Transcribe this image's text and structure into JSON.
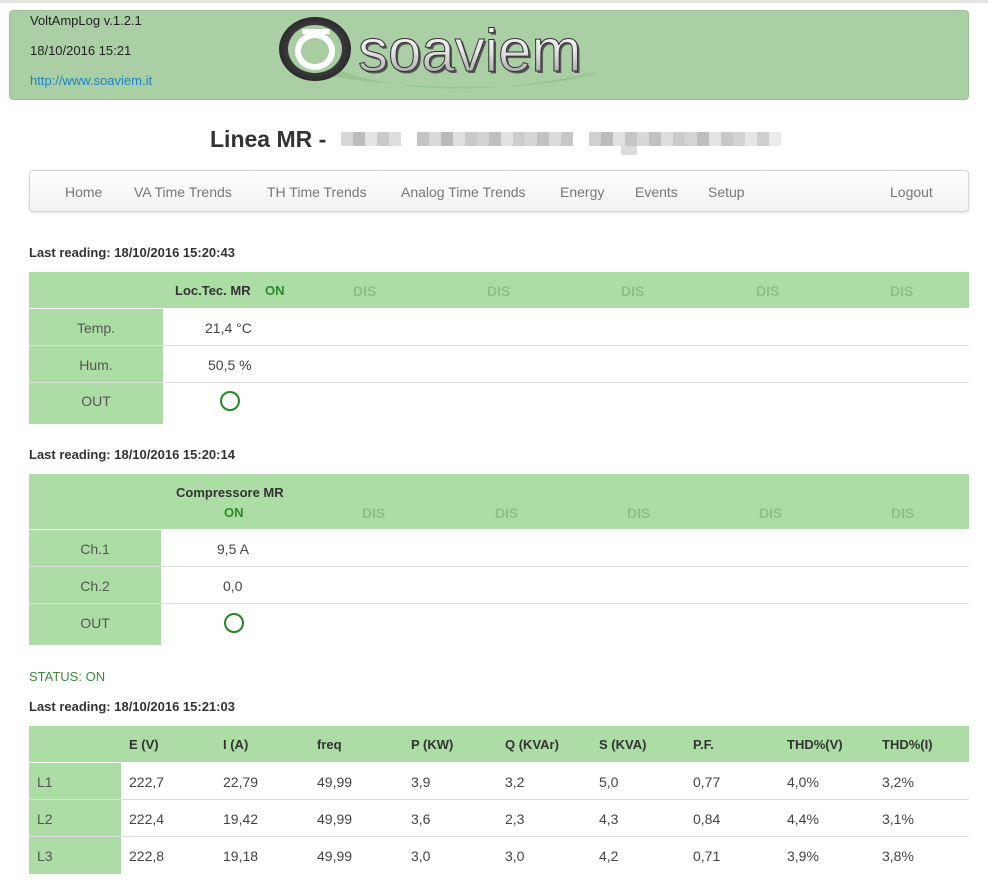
{
  "header": {
    "app_name": "VoltAmpLog v.1.2.1",
    "datetime": "18/10/2016 15:21",
    "link": "http://www.soaviem.it",
    "logo_text": "soaviem"
  },
  "page_title": "Linea MR -",
  "nav": {
    "items": [
      "Home",
      "VA Time Trends",
      "TH Time Trends",
      "Analog Time Trends",
      "Energy",
      "Events",
      "Setup"
    ],
    "logout": "Logout"
  },
  "th_section": {
    "reading": "Last reading: 18/10/2016 15:20:43",
    "device_name": "Loc.Tec. MR",
    "device_state": "ON",
    "dis": [
      "DIS",
      "DIS",
      "DIS",
      "DIS",
      "DIS"
    ],
    "rows": [
      {
        "label": "Temp.",
        "value": "21,4 °C"
      },
      {
        "label": "Hum.",
        "value": "50,5 %"
      },
      {
        "label": "OUT",
        "value": ""
      }
    ]
  },
  "va_section": {
    "reading": "Last reading: 18/10/2016 15:20:14",
    "device_name": "Compressore MR",
    "device_state": "ON",
    "dis": [
      "DIS",
      "DIS",
      "DIS",
      "DIS",
      "DIS"
    ],
    "rows": [
      {
        "label": "Ch.1",
        "value": "9,5 A"
      },
      {
        "label": "Ch.2",
        "value": "0,0"
      },
      {
        "label": "OUT",
        "value": ""
      }
    ]
  },
  "status": "STATUS: ON",
  "energy_section": {
    "reading": "Last reading: 18/10/2016 15:21:03",
    "columns": [
      "E (V)",
      "I (A)",
      "freq",
      "P (KW)",
      "Q (KVAr)",
      "S (KVA)",
      "P.F.",
      "THD%(V)",
      "THD%(I)"
    ],
    "rows": [
      {
        "label": "L1",
        "values": [
          "222,7",
          "22,79",
          "49,99",
          "3,9",
          "3,2",
          "5,0",
          "0,77",
          "4,0%",
          "3,2%"
        ]
      },
      {
        "label": "L2",
        "values": [
          "222,4",
          "19,42",
          "49,99",
          "3,6",
          "2,3",
          "4,3",
          "0,84",
          "4,4%",
          "3,1%"
        ]
      },
      {
        "label": "L3",
        "values": [
          "222,8",
          "19,18",
          "49,99",
          "3,0",
          "3,0",
          "4,2",
          "0,71",
          "3,9%",
          "3,8%"
        ]
      }
    ]
  }
}
